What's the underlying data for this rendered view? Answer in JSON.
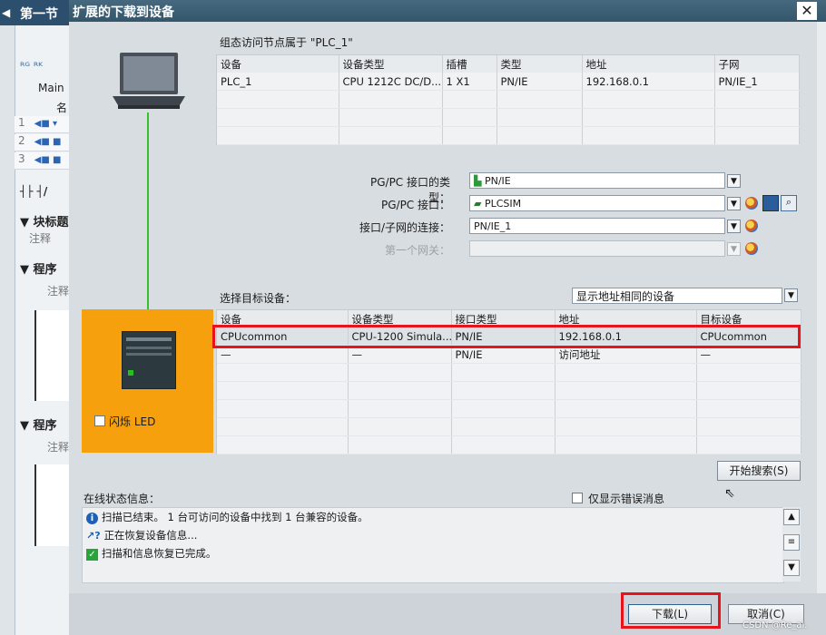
{
  "background_window": {
    "title": "第一节",
    "icons_row": "ᴿᴳ ᴿᴷ",
    "main_label": "Main",
    "col_label": "名",
    "rows": [
      "1",
      "2",
      "3"
    ],
    "ladder_label": "┤├ ┤/",
    "block_title": "▼ 块标题",
    "comment1": "注释",
    "network1": "▼ 程序",
    "comment2": "注释",
    "network2": "▼ 程序",
    "comment3": "注释"
  },
  "dialog": {
    "title": "扩展的下载到设备",
    "close": "✕",
    "config_title": "组态访问节点属于 \"PLC_1\"",
    "config_table": {
      "headers": [
        "设备",
        "设备类型",
        "插槽",
        "类型",
        "地址",
        "子网"
      ],
      "rows": [
        [
          "PLC_1",
          "CPU 1212C DC/D...",
          "1 X1",
          "PN/IE",
          "192.168.0.1",
          "PN/IE_1"
        ]
      ]
    },
    "pgpc_type_label": "PG/PC 接口的类型：",
    "pgpc_type_value": "PN/IE",
    "pgpc_iface_label": "PG/PC 接口：",
    "pgpc_iface_value": "PLCSIM",
    "subnet_label": "接口/子网的连接：",
    "subnet_value": "PN/IE_1",
    "gateway_label": "第一个网关：",
    "gateway_value": "",
    "select_target_label": "选择目标设备：",
    "filter_value": "显示地址相同的设备",
    "target_table": {
      "headers": [
        "设备",
        "设备类型",
        "接口类型",
        "地址",
        "目标设备"
      ],
      "rows": [
        [
          "CPUcommon",
          "CPU-1200 Simula...",
          "PN/IE",
          "192.168.0.1",
          "CPUcommon"
        ],
        [
          "—",
          "—",
          "PN/IE",
          "访问地址",
          "—"
        ]
      ]
    },
    "flash_led_label": "闪烁 LED",
    "start_search_button": "开始搜索(S)",
    "online_status_label": "在线状态信息：",
    "only_errors_label": "仅显示错误消息",
    "messages": [
      {
        "icon": "info-icon",
        "text": "扫描已结束。 1 台可访问的设备中找到 1 台兼容的设备。"
      },
      {
        "icon": "progress-icon",
        "text": "正在恢复设备信息..."
      },
      {
        "icon": "check-icon",
        "text": "扫描和信息恢复已完成。"
      }
    ],
    "download_button": "下载(L)",
    "cancel_button": "取消(C)",
    "watermark": "CSDN @Re_ai."
  },
  "colors": {
    "orange_panel": "#f5a00c",
    "red_highlight": "#e8141c",
    "title_bar": "#3c5f74"
  }
}
